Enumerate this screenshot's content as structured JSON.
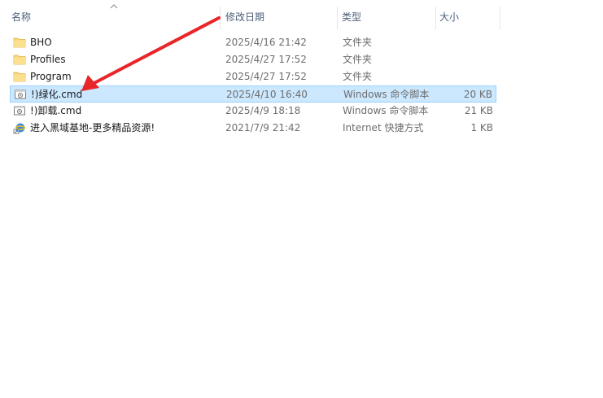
{
  "columns": {
    "name": "名称",
    "modified": "修改日期",
    "type": "类型",
    "size": "大小"
  },
  "files": [
    {
      "name": "BHO",
      "modified": "2025/4/16 21:42",
      "type": "文件夹",
      "size": "",
      "icon": "folder-icon",
      "selected": false
    },
    {
      "name": "Profiles",
      "modified": "2025/4/27 17:52",
      "type": "文件夹",
      "size": "",
      "icon": "folder-icon",
      "selected": false
    },
    {
      "name": "Program",
      "modified": "2025/4/27 17:52",
      "type": "文件夹",
      "size": "",
      "icon": "folder-icon",
      "selected": false
    },
    {
      "name": "!)绿化.cmd",
      "modified": "2025/4/10 16:40",
      "type": "Windows 命令脚本",
      "size": "20 KB",
      "icon": "cmd-script-icon",
      "selected": true
    },
    {
      "name": "!)卸载.cmd",
      "modified": "2025/4/9 18:18",
      "type": "Windows 命令脚本",
      "size": "21 KB",
      "icon": "cmd-script-icon",
      "selected": false
    },
    {
      "name": "进入黑域基地-更多精品资源!",
      "modified": "2021/7/9 21:42",
      "type": "Internet 快捷方式",
      "size": "1 KB",
      "icon": "internet-shortcut-icon",
      "selected": false
    }
  ],
  "colors": {
    "selection_bg": "#cce8ff",
    "selection_border": "#99d1ff",
    "annotation_arrow": "#e8262a",
    "folder": "#f8d775"
  }
}
